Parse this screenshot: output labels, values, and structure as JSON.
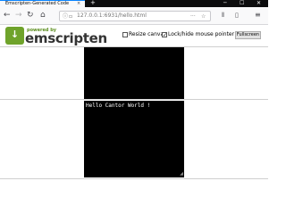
{
  "browser": {
    "tab_title": "Emscripten-Generated Code",
    "tab_close": "×",
    "new_tab": "+",
    "url": "127.0.0.1:6931/hello.html",
    "controls": {
      "minimize": "─",
      "maximize": "☐",
      "close": "✕"
    }
  },
  "header": {
    "powered_by": "powered by",
    "logo_text": "emscripten",
    "logo_arrow": "↓",
    "resize_canvas_label": "Resize canvas",
    "lock_pointer_label": "Lock/hide mouse pointer",
    "resize_canvas_checked": false,
    "lock_pointer_checked": true,
    "fullscreen_label": "Fullscreen"
  },
  "output": {
    "text": "Hello Cantor World !"
  },
  "icons": [
    "back-icon",
    "forward-icon",
    "reload-icon",
    "home-icon",
    "info-icon",
    "lock-icon",
    "page-actions-icon",
    "bookmark-star-icon",
    "library-icon",
    "sidebar-icon",
    "menu-icon"
  ],
  "colors": {
    "logo_green": "#6fa32b",
    "canvas": "#000000",
    "tab_accent": "#0a84ff"
  }
}
